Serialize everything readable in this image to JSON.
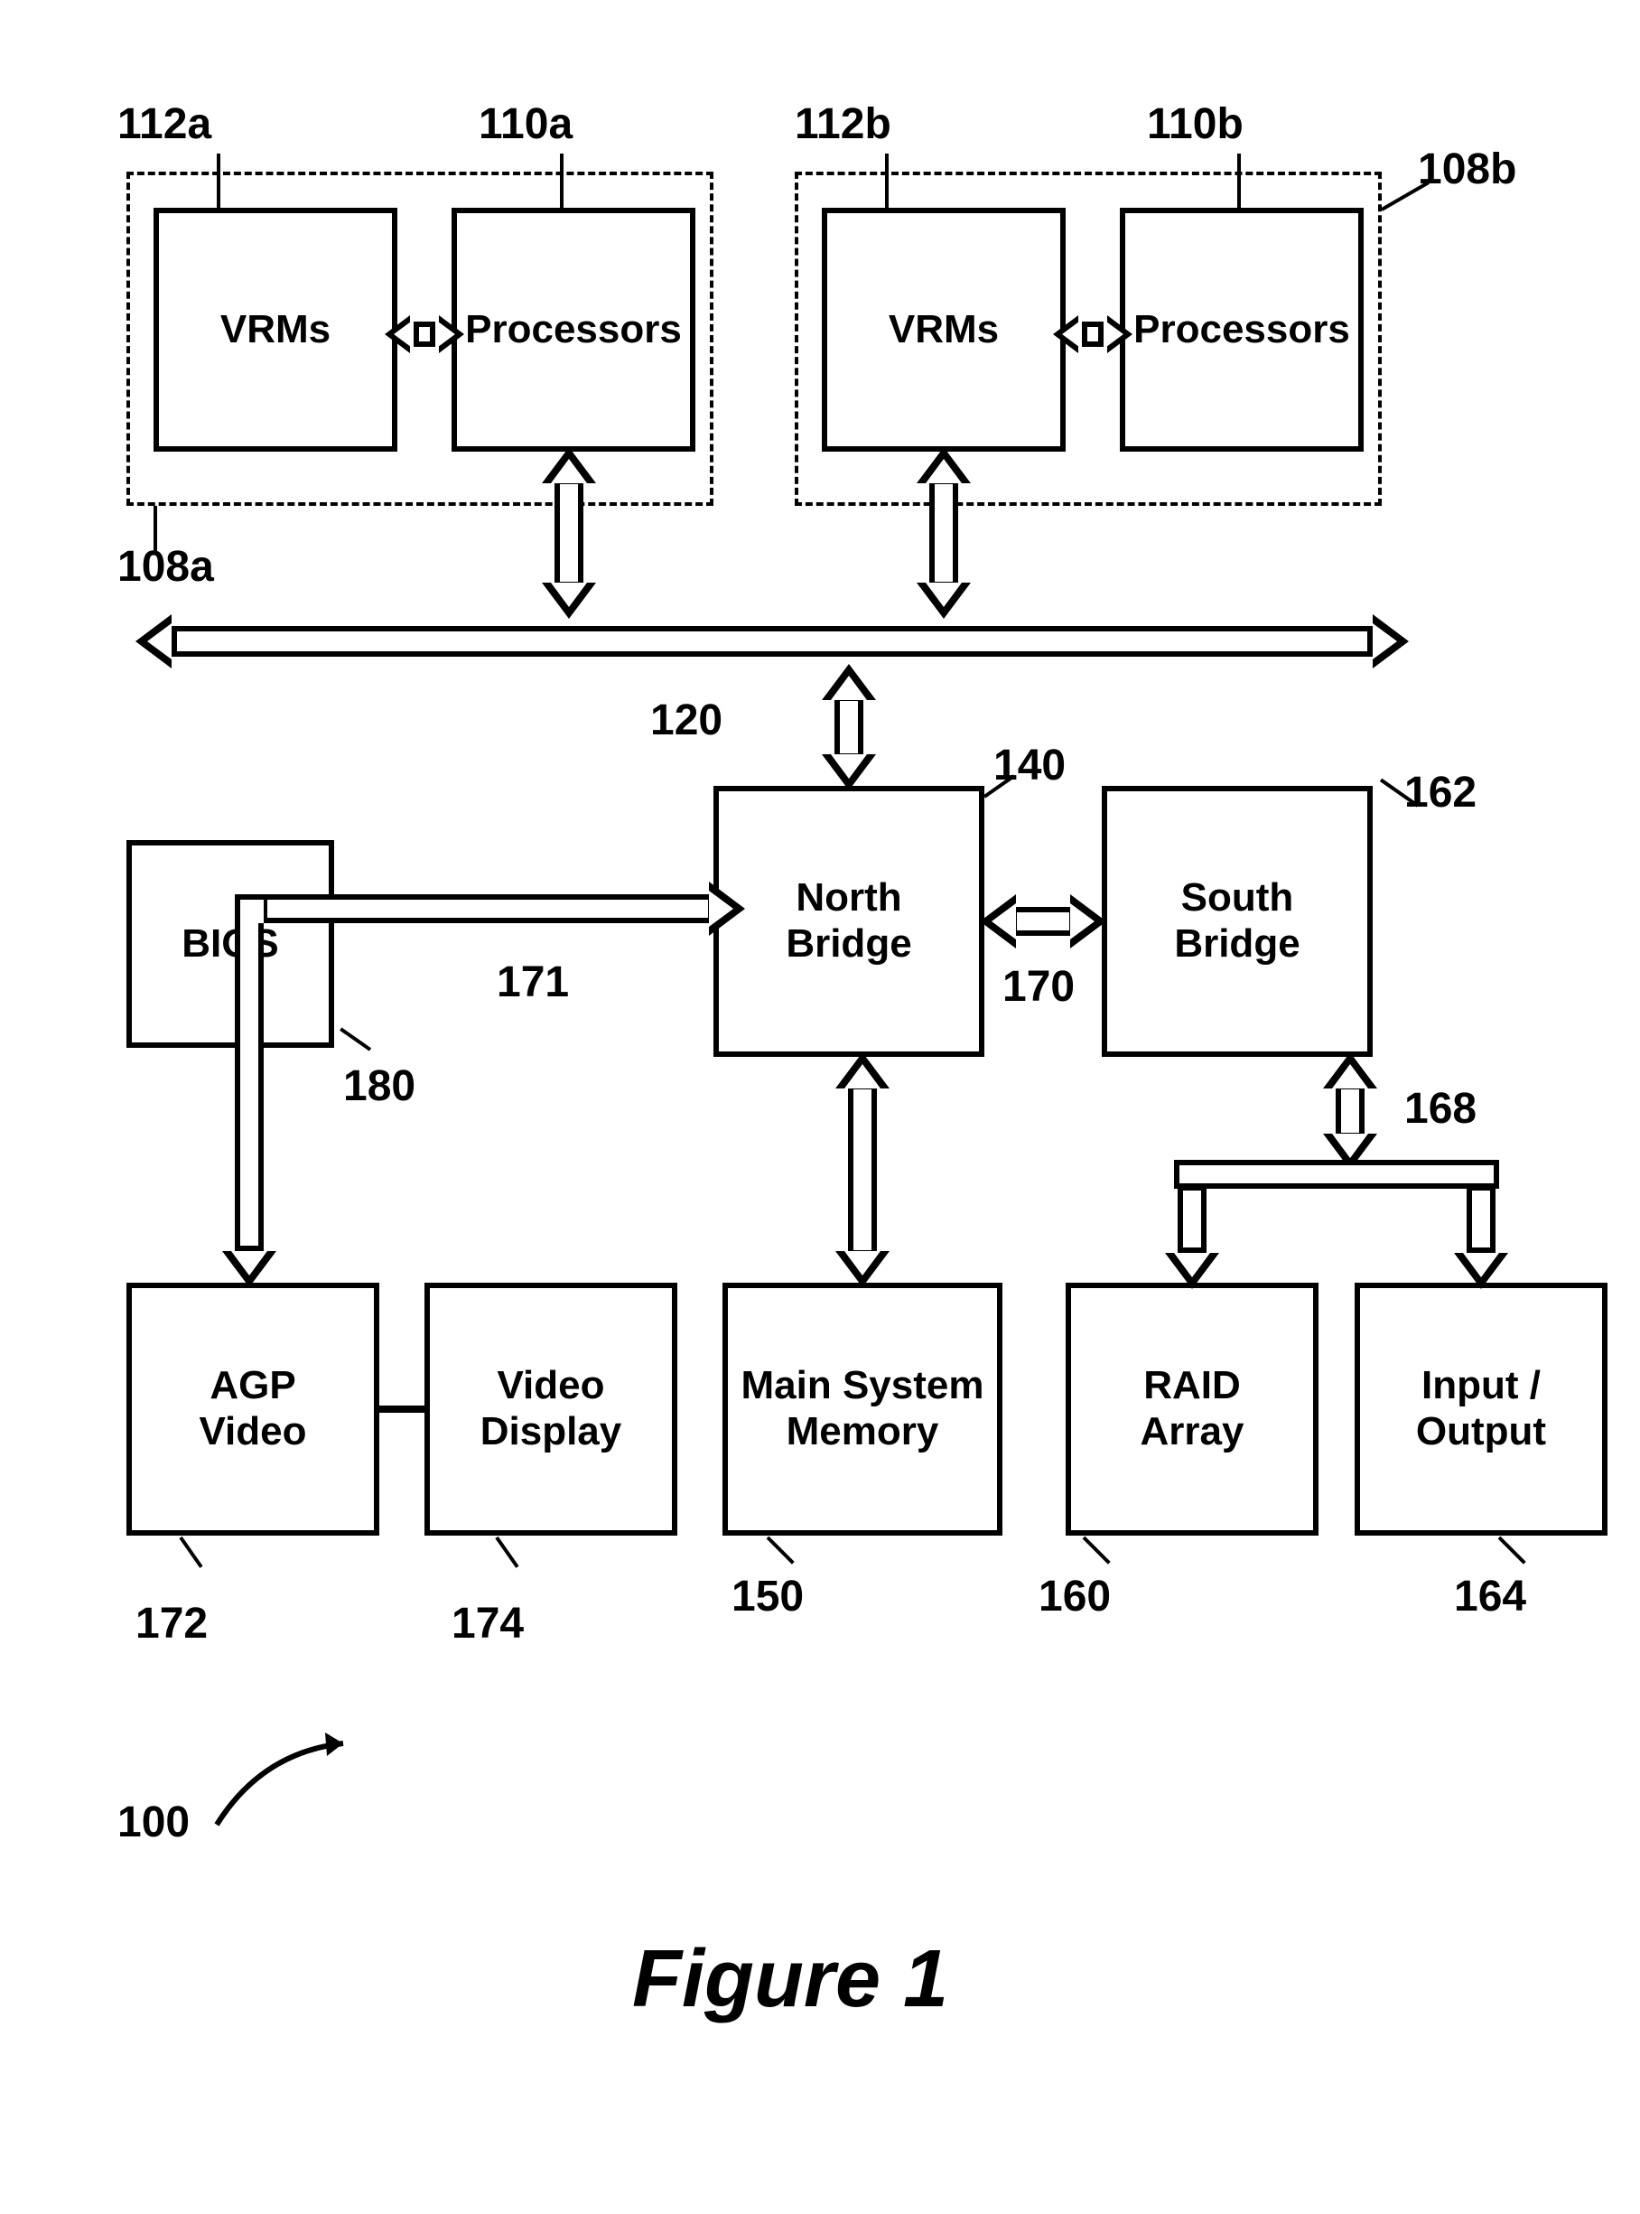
{
  "figure_caption": "Figure 1",
  "refnums": {
    "system": "100",
    "group_a": "108a",
    "group_b": "108b",
    "proc_a": "110a",
    "proc_b": "110b",
    "vrm_a": "112a",
    "vrm_b": "112b",
    "host_bus": "120",
    "north_bridge": "140",
    "memory": "150",
    "raid": "160",
    "south_bridge": "162",
    "io": "164",
    "io_bus": "168",
    "nb_sb_bus": "170",
    "agp_bus": "171",
    "agp_video": "172",
    "video_display": "174",
    "bios": "180"
  },
  "blocks": {
    "vrm_a": "VRMs",
    "proc_a": "Processors",
    "vrm_b": "VRMs",
    "proc_b": "Processors",
    "north_bridge": "North\nBridge",
    "south_bridge": "South\nBridge",
    "memory": "Main System\nMemory",
    "raid": "RAID\nArray",
    "io": "Input /\nOutput",
    "agp_video": "AGP\nVideo",
    "video_display": "Video\nDisplay",
    "bios": "BIOS"
  }
}
